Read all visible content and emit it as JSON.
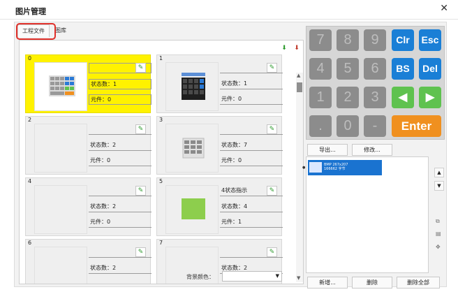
{
  "window": {
    "title": "图片管理",
    "close": "✕"
  },
  "tabs": [
    {
      "label": "工程文件"
    },
    {
      "label": "图库"
    }
  ],
  "cells": [
    {
      "num": "0",
      "field": "",
      "states": "状态数：1",
      "elements": "元件：0",
      "selected": true
    },
    {
      "num": "1",
      "field": "",
      "states": "状态数：1",
      "elements": "元件：0",
      "selected": false
    },
    {
      "num": "2",
      "field": "",
      "states": "状态数：2",
      "elements": "元件：0",
      "selected": false
    },
    {
      "num": "3",
      "field": "",
      "states": "状态数：7",
      "elements": "元件：0",
      "selected": false
    },
    {
      "num": "4",
      "field": "",
      "states": "状态数：2",
      "elements": "元件：0",
      "selected": false
    },
    {
      "num": "5",
      "field": "4状态指示",
      "states": "状态数：4",
      "elements": "元件：1",
      "selected": false
    },
    {
      "num": "6",
      "field": "",
      "states": "状态数：2",
      "elements": "",
      "selected": false
    },
    {
      "num": "7",
      "field": "",
      "states": "状态数：2",
      "elements": "",
      "selected": false
    }
  ],
  "bottom": {
    "bg_color_label": "背景颜色：",
    "bg_color_value": ""
  },
  "preview": {
    "keys": [
      "7",
      "8",
      "9",
      "Clr",
      "Esc",
      "4",
      "5",
      "6",
      "BS",
      "Del",
      "1",
      "2",
      "3",
      "◀",
      "▶",
      ".",
      "0",
      "-",
      "Enter"
    ],
    "colors": {
      "num": "#8c8c8c",
      "blue": "#1a7fd6",
      "green": "#5fc24f",
      "orange": "#f0901f"
    }
  },
  "actions": {
    "export": "导出...",
    "modify": "修改...",
    "add": "新增...",
    "delete": "删除",
    "delete_all": "删除全部"
  },
  "list": {
    "item_line1": "BMP 267x207",
    "item_line2": "166662 字节"
  }
}
